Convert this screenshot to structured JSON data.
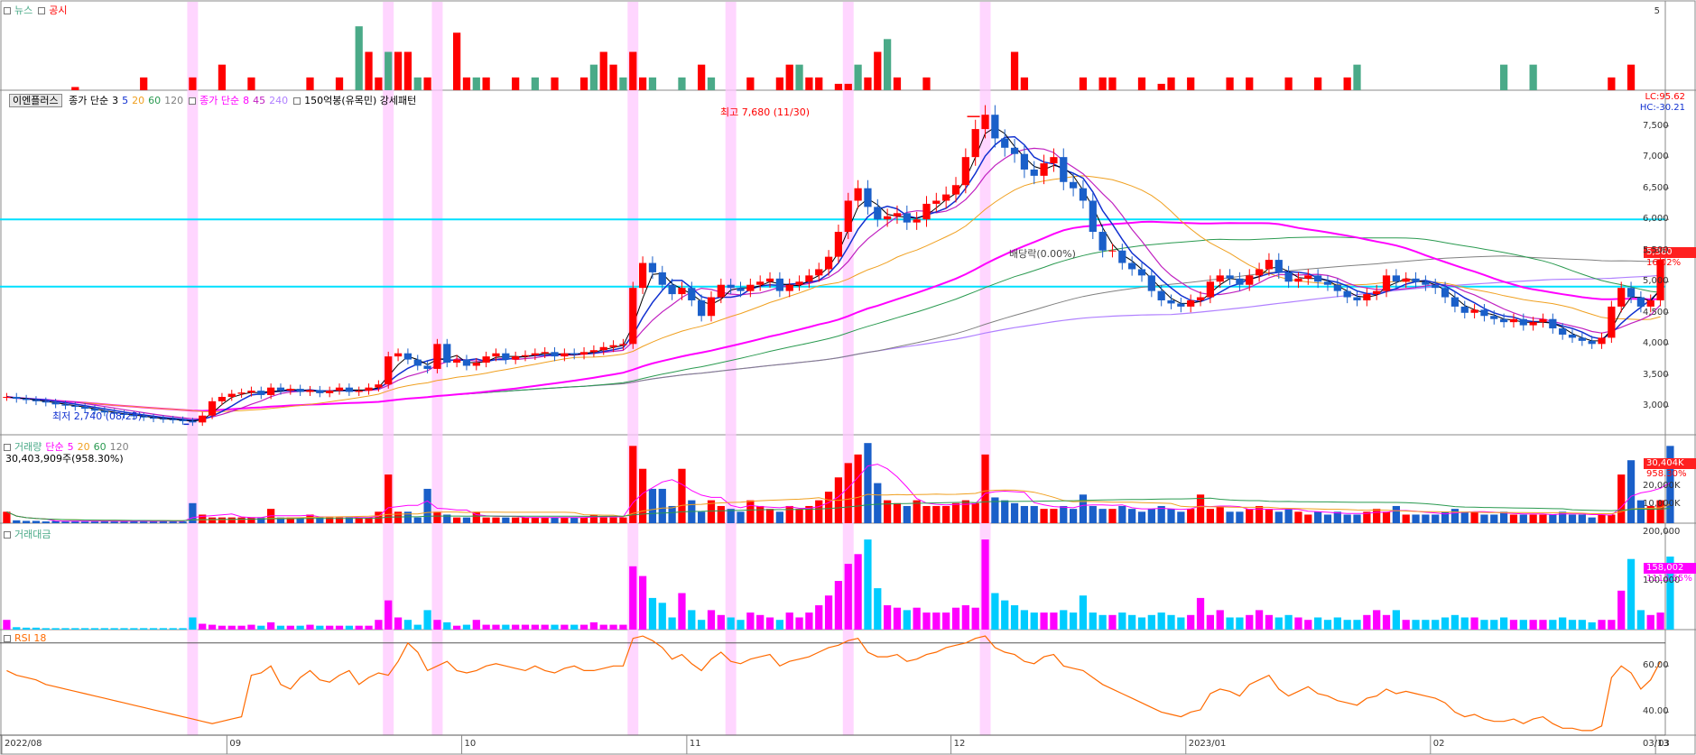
{
  "colors": {
    "up": "#ff0000",
    "down": "#1a5fc9",
    "ma3": "#000000",
    "ma5": "#1030d0",
    "ma20": "#f0a020",
    "ma60": "#2a9a50",
    "ma120": "#808080",
    "vma8": "#ff00ff",
    "vma45": "#c020c0",
    "vma240": "#b080ff",
    "hline": "#00e0ff",
    "highlight": "#ffc8ff",
    "newsGreen": "#4aaa88",
    "newsRed": "#ff0000",
    "turnover": "#ff00ff",
    "turnoverAlt": "#00ccff",
    "rsi": "#ff6a00"
  },
  "news": {
    "label1": "뉴스",
    "label2": "공시",
    "scale": "5"
  },
  "price": {
    "btn": "이엔플러스",
    "ma_label": "종가 단순",
    "ma_periods": [
      "3",
      "5",
      "20",
      "60",
      "120"
    ],
    "vma_label": "종가 단순",
    "vma_periods": [
      "8",
      "45",
      "240"
    ],
    "pattern": "150억봉(유목민) 강세패턴",
    "lc": "LC:95.62",
    "hc": "HC:-30.21",
    "high_label": "최고 7,680 (11/30)",
    "low_label": "최저 2,740 (08/25)",
    "div_label": "배당락(0.00%)",
    "last_price": "5,360",
    "last_pct": "16.02%",
    "yticks": [
      "7,500",
      "7,000",
      "6,500",
      "6,000",
      "5,500",
      "5,000",
      "4,500",
      "4,000",
      "3,500",
      "3,000"
    ]
  },
  "volume": {
    "label": "거래량",
    "ma_label": "단순",
    "ma_periods": [
      "5",
      "20",
      "60",
      "120"
    ],
    "info": "30,403,909주(958.30%)",
    "last": "30,404K",
    "last_pct": "958.30%",
    "yticks": [
      "20,000K",
      "10,000K"
    ]
  },
  "turnover": {
    "label": "거래대금",
    "last": "158,002",
    "last_pct": "1113.55%",
    "yticks": [
      "200,000",
      "100,000"
    ]
  },
  "rsi": {
    "label": "RSI 18",
    "yticks": [
      "60.00",
      "40.00"
    ]
  },
  "xaxis": {
    "labels": [
      "2022/08",
      "09",
      "10",
      "11",
      "12",
      "2023/01",
      "02",
      "03"
    ],
    "right": "03/13"
  },
  "chart_data": {
    "type": "candlestick",
    "x_months": [
      "2022/08",
      "09",
      "10",
      "11",
      "12",
      "2023/01",
      "02",
      "03"
    ],
    "ylim": [
      2600,
      7900
    ],
    "hlines": [
      6000,
      4920
    ],
    "high": {
      "value": 7680,
      "date": "11/30"
    },
    "low": {
      "value": 2740,
      "date": "08/25"
    },
    "last_close": 5360,
    "last_change_pct": 16.02,
    "closes": [
      3150,
      3120,
      3100,
      3080,
      3060,
      3030,
      3010,
      2990,
      2960,
      2930,
      2900,
      2880,
      2860,
      2840,
      2820,
      2800,
      2790,
      2780,
      2760,
      2740,
      2850,
      3080,
      3150,
      3200,
      3220,
      3250,
      3180,
      3300,
      3250,
      3280,
      3230,
      3260,
      3210,
      3250,
      3300,
      3230,
      3250,
      3300,
      3350,
      3800,
      3850,
      3750,
      3650,
      3600,
      4000,
      3700,
      3750,
      3650,
      3700,
      3800,
      3850,
      3750,
      3800,
      3820,
      3850,
      3870,
      3800,
      3850,
      3830,
      3870,
      3900,
      3950,
      3980,
      4000,
      4900,
      5300,
      5150,
      4950,
      4800,
      4900,
      4700,
      4450,
      4750,
      4950,
      4900,
      4850,
      4950,
      5000,
      5050,
      4850,
      4950,
      5000,
      5100,
      5200,
      5400,
      5800,
      6300,
      6500,
      6200,
      6000,
      6050,
      6100,
      5950,
      6000,
      6250,
      6300,
      6400,
      6550,
      7000,
      7450,
      7680,
      7300,
      7150,
      7050,
      6800,
      6700,
      6900,
      7000,
      6600,
      6500,
      6300,
      5800,
      5500,
      5500,
      5300,
      5200,
      5100,
      4850,
      4700,
      4650,
      4600,
      4700,
      4750,
      5000,
      5100,
      5050,
      4950,
      5100,
      5200,
      5350,
      5150,
      5000,
      5050,
      5100,
      5000,
      4950,
      4850,
      4750,
      4700,
      4800,
      4850,
      5100,
      5000,
      5050,
      5000,
      4950,
      4900,
      4750,
      4600,
      4500,
      4550,
      4450,
      4400,
      4350,
      4400,
      4300,
      4350,
      4400,
      4250,
      4150,
      4100,
      4050,
      4000,
      4100,
      4600,
      4900,
      4750,
      4600,
      4700,
      5360
    ],
    "volumes": [
      2,
      0.5,
      0.4,
      0.4,
      0.3,
      0.4,
      0.3,
      0.4,
      0.3,
      0.3,
      0.4,
      0.3,
      0.3,
      0.4,
      0.3,
      0.3,
      0.4,
      0.3,
      0.3,
      3.5,
      1.5,
      1,
      1,
      1,
      1,
      1,
      1,
      2.5,
      1,
      1,
      1,
      1.5,
      1,
      1,
      1,
      1,
      1,
      1,
      2,
      8.5,
      2,
      2,
      1,
      6,
      2,
      1.5,
      1,
      1,
      2,
      1,
      1,
      1,
      1,
      1,
      1,
      1,
      1,
      1,
      1,
      1,
      1.5,
      1,
      1,
      1,
      13.5,
      9.5,
      6,
      6,
      3,
      9.5,
      4,
      2,
      4,
      3,
      2.5,
      2,
      4,
      3,
      2.5,
      2,
      3,
      2.5,
      3,
      4,
      5.5,
      8,
      10.5,
      12,
      14,
      7,
      4,
      3.5,
      3,
      4,
      3,
      3,
      3,
      3.5,
      4,
      3.5,
      12,
      4.5,
      4,
      3.5,
      3,
      3,
      2.5,
      2.5,
      3,
      2.5,
      5,
      3,
      2.5,
      2.5,
      3,
      2.5,
      2,
      2.5,
      3,
      2.5,
      2,
      2.5,
      5,
      2.5,
      3,
      2,
      2,
      2.5,
      3,
      2.5,
      2,
      2.5,
      2,
      1.5,
      2,
      1.5,
      2,
      1.5,
      1.5,
      2,
      2.5,
      2,
      3,
      1.5,
      1.5,
      1.5,
      1.5,
      2,
      2.5,
      2,
      2,
      1.5,
      1.5,
      2,
      1.5,
      1.5,
      1.5,
      1.5,
      1.5,
      2,
      1.5,
      1.5,
      1,
      1.5,
      1.5,
      8.5,
      11,
      4,
      3,
      4,
      13.5
    ],
    "turnover": [
      20,
      5,
      4,
      4,
      3,
      3,
      3,
      3,
      3,
      3,
      3,
      3,
      3,
      3,
      3,
      3,
      3,
      3,
      3,
      25,
      12,
      10,
      8,
      8,
      8,
      10,
      8,
      15,
      8,
      8,
      8,
      10,
      8,
      8,
      8,
      8,
      8,
      8,
      20,
      60,
      25,
      20,
      10,
      40,
      20,
      15,
      8,
      10,
      20,
      10,
      10,
      10,
      10,
      10,
      10,
      10,
      10,
      10,
      10,
      10,
      15,
      10,
      10,
      10,
      130,
      110,
      65,
      55,
      25,
      75,
      40,
      20,
      40,
      30,
      25,
      20,
      35,
      30,
      25,
      20,
      35,
      25,
      35,
      50,
      70,
      100,
      135,
      155,
      185,
      85,
      50,
      45,
      40,
      45,
      35,
      35,
      35,
      45,
      50,
      45,
      185,
      75,
      60,
      50,
      40,
      35,
      35,
      35,
      40,
      35,
      70,
      35,
      30,
      30,
      35,
      30,
      25,
      30,
      35,
      30,
      25,
      30,
      65,
      30,
      40,
      25,
      25,
      30,
      40,
      30,
      25,
      30,
      25,
      20,
      25,
      20,
      25,
      20,
      20,
      30,
      40,
      30,
      40,
      20,
      20,
      20,
      20,
      25,
      30,
      25,
      25,
      20,
      20,
      25,
      20,
      20,
      20,
      20,
      20,
      25,
      20,
      20,
      15,
      20,
      20,
      80,
      145,
      40,
      30,
      35,
      150
    ],
    "rsi": [
      58,
      56,
      55,
      54,
      52,
      51,
      50,
      49,
      48,
      47,
      46,
      45,
      44,
      43,
      42,
      41,
      40,
      39,
      38,
      37,
      36,
      35,
      36,
      37,
      38,
      56,
      57,
      60,
      52,
      50,
      55,
      58,
      54,
      53,
      56,
      58,
      52,
      55,
      57,
      56,
      62,
      70,
      66,
      58,
      60,
      62,
      58,
      57,
      58,
      60,
      61,
      60,
      59,
      58,
      60,
      58,
      57,
      59,
      60,
      58,
      58,
      59,
      60,
      60,
      72,
      73,
      71,
      68,
      63,
      65,
      61,
      58,
      63,
      66,
      62,
      61,
      63,
      64,
      65,
      60,
      62,
      63,
      64,
      66,
      68,
      69,
      71,
      72,
      66,
      64,
      64,
      65,
      62,
      63,
      65,
      66,
      68,
      69,
      70,
      72,
      73,
      68,
      66,
      65,
      62,
      61,
      64,
      65,
      60,
      59,
      58,
      55,
      52,
      50,
      48,
      46,
      44,
      42,
      40,
      39,
      38,
      40,
      41,
      48,
      50,
      49,
      47,
      52,
      54,
      56,
      50,
      47,
      49,
      51,
      48,
      47,
      45,
      44,
      43,
      46,
      47,
      50,
      48,
      49,
      48,
      47,
      46,
      44,
      40,
      38,
      39,
      37,
      36,
      36,
      37,
      35,
      37,
      38,
      35,
      33,
      33,
      32,
      32,
      34,
      55,
      60,
      57,
      50,
      54,
      62
    ]
  }
}
